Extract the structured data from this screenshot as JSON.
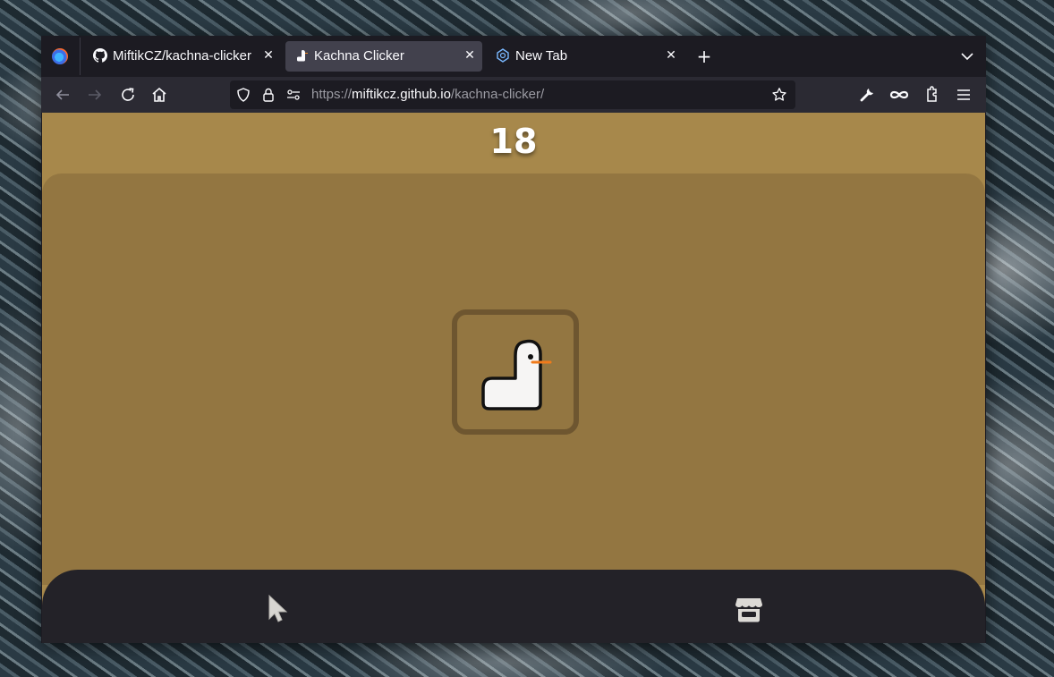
{
  "browser": {
    "tabs": [
      {
        "title": "MiftikCZ/kachna-clicker",
        "favicon": "github-icon",
        "active": false
      },
      {
        "title": "Kachna Clicker",
        "favicon": "duck-icon",
        "active": true
      },
      {
        "title": "New Tab",
        "favicon": "firefox-view-icon",
        "active": false
      }
    ],
    "url": {
      "scheme": "https://",
      "host": "miftikcz.github.io",
      "path": "/kachna-clicker/"
    }
  },
  "game": {
    "counter": "18",
    "colors": {
      "background": "#a7884b",
      "play_area": "#937641",
      "button_border": "#6e5630",
      "nav_bar": "#232228"
    },
    "nav": [
      {
        "name": "clicker",
        "icon": "cursor-icon"
      },
      {
        "name": "shop",
        "icon": "shop-icon"
      }
    ]
  }
}
